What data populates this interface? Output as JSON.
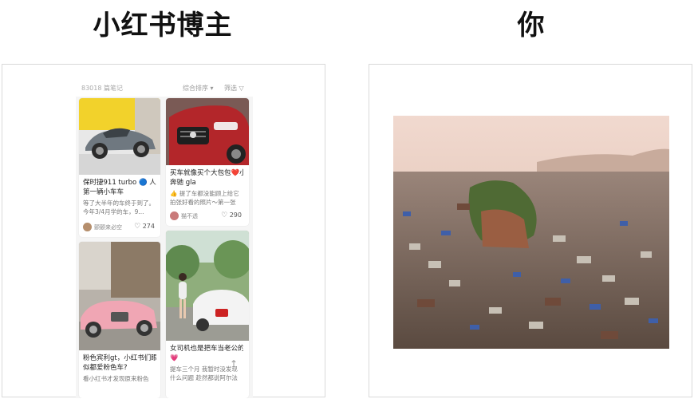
{
  "headings": {
    "left": "小红书博主",
    "right": "你"
  },
  "feed": {
    "count_label": "83018 篇笔记",
    "sort_label": "综合排序 ▾",
    "filter_label": "筛选 ▽",
    "cards": [
      {
        "title": "保时捷911 turbo 🔵 人生",
        "title2": "第一辆小车车",
        "snippet": "等了大半年的车终于到了。今年3/4月学的车，9...",
        "author": "颤颤来必空",
        "likes": "274"
      },
      {
        "title": "买车就像买个大包包❤️小",
        "title2": "奔驰 gla",
        "snippet": "👍 提了车都没能顾上给它拍张好看的照片～第一张",
        "author": "猫不透",
        "likes": "290"
      },
      {
        "title": "粉色宾利gt，小红书们眼",
        "title2": "似都爱粉色车?",
        "snippet": "看小红书才发现原来粉色"
      },
      {
        "title": "女司机也是把车当老公的",
        "title2": "💗",
        "snippet": "提车三个月 我暂时没发现什么问题 趁然都说阿尔法"
      }
    ]
  },
  "colors": {
    "heading": "#111111",
    "panel_border": "#d9d9d9",
    "porsche": "#6f7880",
    "mercedes": "#b3262a",
    "bentley": "#f0a6b4",
    "alfa": "#f3f3f3"
  },
  "icons": [
    "heart-icon",
    "avatar",
    "scroll-top-icon"
  ]
}
